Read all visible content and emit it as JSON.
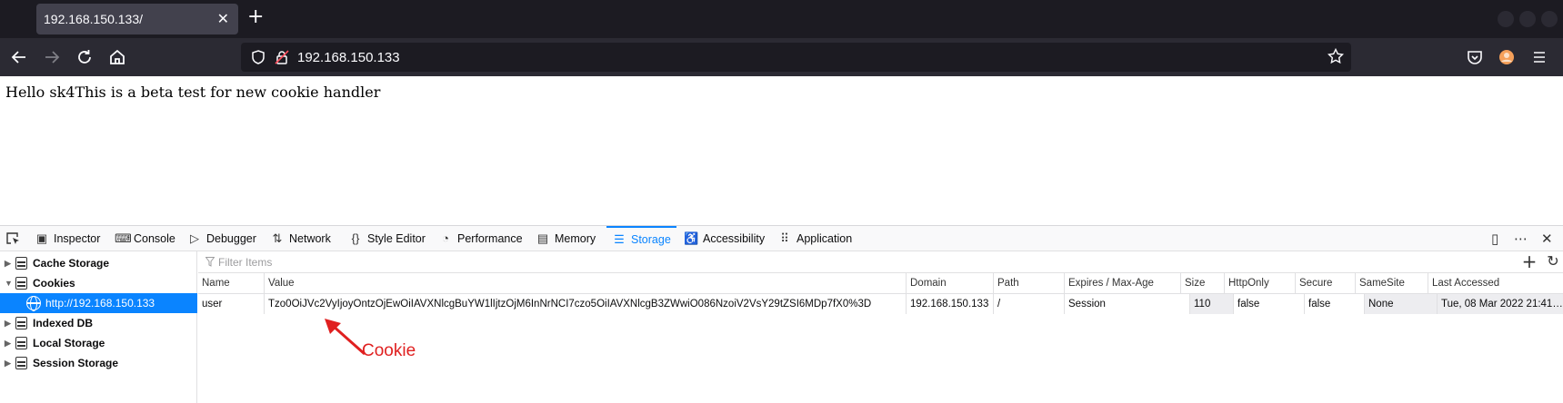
{
  "browser": {
    "tab_title": "192.168.150.133/",
    "url": "192.168.150.133"
  },
  "page": {
    "text": "Hello sk4This is a beta test for new cookie handler"
  },
  "devtools": {
    "tabs": [
      {
        "label": "Inspector",
        "icon": "inspector-icon"
      },
      {
        "label": "Console",
        "icon": "console-icon"
      },
      {
        "label": "Debugger",
        "icon": "debugger-icon"
      },
      {
        "label": "Network",
        "icon": "network-icon"
      },
      {
        "label": "Style Editor",
        "icon": "style-editor-icon"
      },
      {
        "label": "Performance",
        "icon": "performance-icon"
      },
      {
        "label": "Memory",
        "icon": "memory-icon"
      },
      {
        "label": "Storage",
        "icon": "storage-icon",
        "active": true
      },
      {
        "label": "Accessibility",
        "icon": "accessibility-icon"
      },
      {
        "label": "Application",
        "icon": "application-icon"
      }
    ],
    "sidebar": {
      "items": [
        {
          "label": "Cache Storage"
        },
        {
          "label": "Cookies"
        },
        {
          "label": "http://192.168.150.133"
        },
        {
          "label": "Indexed DB"
        },
        {
          "label": "Local Storage"
        },
        {
          "label": "Session Storage"
        }
      ]
    },
    "filter_placeholder": "Filter Items",
    "columns": [
      "Name",
      "Value",
      "Domain",
      "Path",
      "Expires / Max-Age",
      "Size",
      "HttpOnly",
      "Secure",
      "SameSite",
      "Last Accessed"
    ],
    "rows": [
      {
        "name": "user",
        "value": "Tzo0OiJVc2VyIjoyOntzOjEwOiIAVXNlcgBuYW1lIjtzOjM6InNrNCI7czo5OiIAVXNlcgB3ZWwiO086NzoiV2VsY29tZSI6MDp7fX0%3D",
        "domain": "192.168.150.133",
        "path": "/",
        "expires": "Session",
        "size": "110",
        "httponly": "false",
        "secure": "false",
        "samesite": "None",
        "last_accessed": "Tue, 08 Mar 2022 21:41:..."
      }
    ]
  },
  "annotation": {
    "label": "Cookie",
    "color": "#e02020"
  }
}
